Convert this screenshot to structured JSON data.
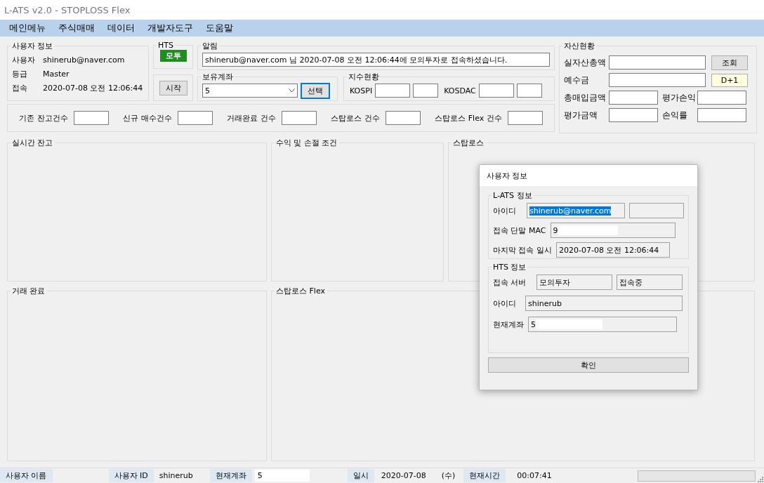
{
  "window": {
    "title": "L-ATS v2.0 - STOPLOSS Flex"
  },
  "menu": [
    "메인메뉴",
    "주식매매",
    "데이터",
    "개발자도구",
    "도움말"
  ],
  "user_info": {
    "title": "사용자 정보",
    "rows": [
      {
        "label": "사용자",
        "value": "shinerub@naver.com"
      },
      {
        "label": "등급",
        "value": "Master"
      },
      {
        "label": "접속",
        "value": "2020-07-08 오전 12:06:44"
      }
    ]
  },
  "hts": {
    "title": "HTS",
    "badge": "모투",
    "start_button": "시작"
  },
  "notice": {
    "title": "알림",
    "value": "shinerub@naver.com 님 2020-07-08 오전 12:06:44에 모의투자로 접속하셨습니다."
  },
  "account": {
    "title": "보유계좌",
    "value": "5",
    "select_button": "선택",
    "select_focused": true
  },
  "index": {
    "title": "지수현황",
    "items": [
      {
        "label": "KOSPI"
      },
      {
        "label": "KOSDAC"
      }
    ]
  },
  "counts": [
    {
      "label": "기존 잔고건수"
    },
    {
      "label": "신규 매수건수"
    },
    {
      "label": "거래완료 건수"
    },
    {
      "label": "스탑로스 건수"
    },
    {
      "label": "스탑로스 Flex 건수"
    }
  ],
  "assets": {
    "title": "자산현황",
    "query_button": "조회",
    "d1_button": "D+1",
    "fields": [
      {
        "label": "실자산총액"
      },
      {
        "label": "예수금"
      },
      {
        "label": "총매입금액"
      },
      {
        "label": "평가손익"
      },
      {
        "label": "평가금액"
      },
      {
        "label": "손익률"
      }
    ]
  },
  "panels": [
    {
      "title": "실시간 잔고"
    },
    {
      "title": "수익 및 손절 조건"
    },
    {
      "title": "스탑로스"
    },
    {
      "title": "거래 완료"
    },
    {
      "title": "스탑로스 Flex"
    }
  ],
  "dialog": {
    "title": "사용자 정보",
    "lats": {
      "title": "L-ATS 정보",
      "id_label": "아이디",
      "id_value": "shinerub@naver.com",
      "id_selected": true,
      "mac_label": "접속 단말 MAC",
      "mac_value": "9",
      "last_label": "마지막 접속 일시",
      "last_value": "2020-07-08 오전 12:06:44"
    },
    "hts": {
      "title": "HTS 정보",
      "server_label": "접속 서버",
      "server_value": "모의투자",
      "server_status": "접속중",
      "id_label": "아이디",
      "id_value": "shinerub",
      "account_label": "현재계좌",
      "account_value": "5"
    },
    "ok_button": "확인"
  },
  "status_bar": {
    "items": [
      {
        "kind": "label",
        "text": "사용자 이름"
      },
      {
        "kind": "label",
        "text": "사용자 ID"
      },
      {
        "kind": "value",
        "text": "shinerub"
      },
      {
        "kind": "label",
        "text": "현재계좌"
      },
      {
        "kind": "field",
        "text": "5"
      },
      {
        "kind": "label",
        "text": "일시"
      },
      {
        "kind": "value",
        "text": "2020-07-08"
      },
      {
        "kind": "value",
        "text": "(수)"
      },
      {
        "kind": "label",
        "text": "현재시간"
      },
      {
        "kind": "value",
        "text": "00:07:41"
      }
    ],
    "progress": {
      "level": 0
    }
  }
}
